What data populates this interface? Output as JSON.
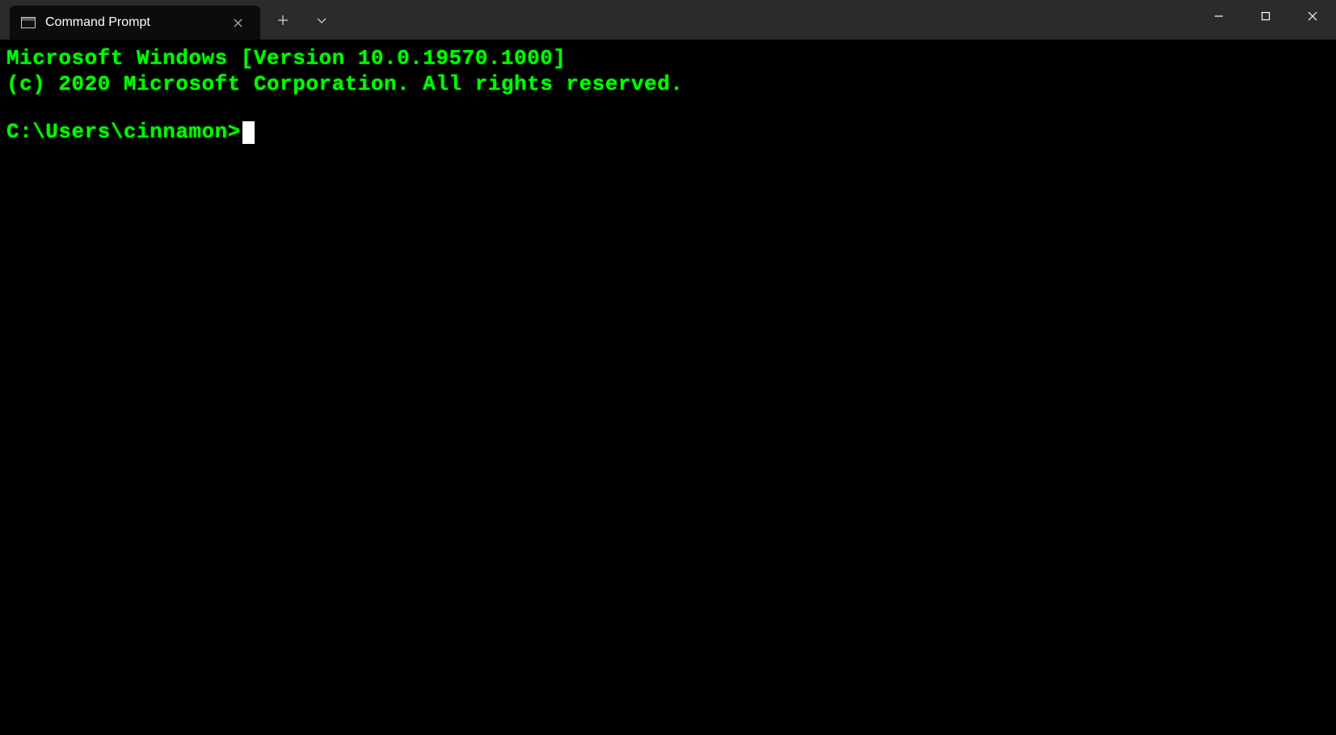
{
  "tab": {
    "title": "Command Prompt"
  },
  "terminal": {
    "line1": "Microsoft Windows [Version 10.0.19570.1000]",
    "line2": "(c) 2020 Microsoft Corporation. All rights reserved.",
    "prompt": "C:\\Users\\cinnamon>"
  },
  "colors": {
    "terminal_fg": "#00ff00",
    "terminal_bg": "#000000",
    "titlebar_bg": "#2b2b2b",
    "tab_active_bg": "#0c0c0c"
  }
}
